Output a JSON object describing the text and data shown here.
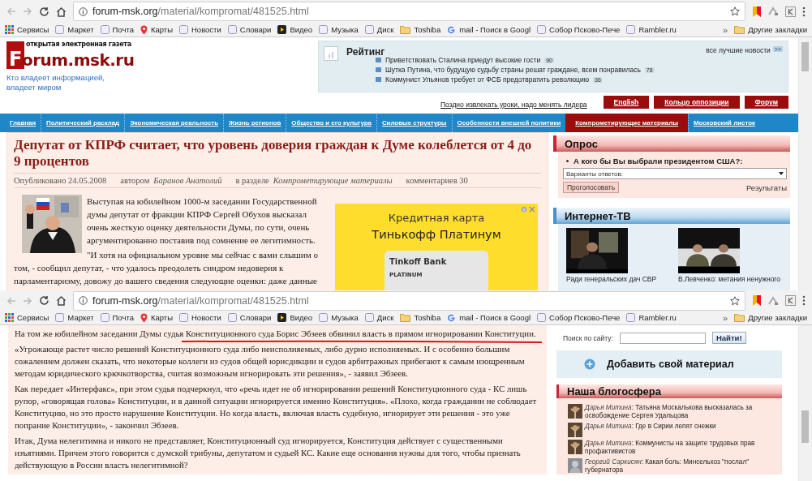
{
  "screens": [
    {
      "kind": "front",
      "browser": {
        "url_host": "forum-msk.org",
        "url_path": "/material/kompromat/481525.html",
        "more": "»",
        "other_bookmarks": "Другие закладки",
        "bookmarks": [
          {
            "label": "Сервисы",
            "kind": "apps"
          },
          {
            "label": "Маркет",
            "kind": "site"
          },
          {
            "label": "Почта",
            "kind": "site"
          },
          {
            "label": "Карты",
            "kind": "pin"
          },
          {
            "label": "Новости",
            "kind": "site"
          },
          {
            "label": "Словари",
            "kind": "site"
          },
          {
            "label": "Видео",
            "kind": "play"
          },
          {
            "label": "Музыка",
            "kind": "site"
          },
          {
            "label": "Диск",
            "kind": "site"
          },
          {
            "label": "Toshiba",
            "kind": "folder"
          },
          {
            "label": "mail - Поиск в Googl",
            "kind": "google"
          },
          {
            "label": "Собор Псково-Пече",
            "kind": "site"
          },
          {
            "label": "Rambler.ru",
            "kind": "site"
          }
        ]
      },
      "header": {
        "logo_top": "открытая электронная газета",
        "logo": "Forum.msk.ru",
        "slogan": "Кто владеет информацией, владеет миром",
        "rating": {
          "title": "Рейтинг",
          "all_link": "все лучшие новости",
          "all_badge": ">>",
          "items": [
            {
              "text": "Приветствовать Сталина приедут высокие гости",
              "count": "90"
            },
            {
              "text": "Шутка Путина, что будущую судьбу страны решат граждане, всем понравилась",
              "count": "78"
            },
            {
              "text": "Коммунист Ульянов требует от ФСБ предотвратить революцию",
              "count": "36"
            }
          ]
        },
        "headline_link": "Поздно извлекать уроки, надо менять лидера",
        "tabs": [
          "English",
          "Кольцо оппозиции",
          "Форум"
        ]
      },
      "nav": [
        {
          "label": "Главная",
          "selected": false
        },
        {
          "label": "Политический расклад",
          "selected": false
        },
        {
          "label": "Экономическая реальность",
          "selected": false
        },
        {
          "label": "Жизнь регионов",
          "selected": false
        },
        {
          "label": "Общество и его культура",
          "selected": false
        },
        {
          "label": "Силовые структуры",
          "selected": false
        },
        {
          "label": "Особенности внешней политики",
          "selected": false
        },
        {
          "label": "Компрометирующие материалы",
          "selected": true
        },
        {
          "label": "Московский листок",
          "selected": false
        }
      ],
      "article": {
        "title": "Депутат от КПРФ считает, что уровень доверия граждан к Думе колеблется от 4 до 9 процентов",
        "published": "Опубликовано 24.05.2008",
        "by": "автором",
        "author": "Баранов Анатолий",
        "in_section": "в разделе",
        "section": "Компрометирующие материалы",
        "comments": "комментариев 30",
        "paragraphs": [
          "Выступая на юбилейном 1000-м заседании Государственной думы депутат от фракции КПРФ Сергей Обухов высказал очень жесткую оценку деятельности Думы, по сути, очень аргументированно поставив под сомнение ее легитимность.",
          "\"И хотя на официальном уровне мы сейчас с вами слышим о том, - сообщил депутат, - что удалось преодолеть синдром недоверия к парламентаризму, довожу до вашего сведения следующие оценки: даже данные"
        ],
        "ad": {
          "line1": "Кредитная карта",
          "line2": "Тинькофф Платинум",
          "card_bank": "Tinkoff Bank",
          "card_tier": "PLATINUM"
        }
      },
      "sidebar": {
        "poll": {
          "title": "Опрос",
          "question": "А кого бы Вы выбрали президентом США?:",
          "select": "Варианты ответов:",
          "vote": "Проголосовать",
          "results": "Результаты"
        },
        "tv": {
          "title": "Интернет-ТВ",
          "videos": [
            {
              "caption": "Ради генеральских дач СВР"
            },
            {
              "caption": "В.Левченко: метания ненужного"
            }
          ]
        }
      }
    },
    {
      "kind": "continued",
      "browser": {
        "url_host": "forum-msk.org",
        "url_path": "/material/kompromat/481525.html",
        "more": "»",
        "other_bookmarks": "Другие закладки",
        "bookmarks": [
          {
            "label": "Сервисы",
            "kind": "apps"
          },
          {
            "label": "Маркет",
            "kind": "site"
          },
          {
            "label": "Почта",
            "kind": "site"
          },
          {
            "label": "Карты",
            "kind": "pin"
          },
          {
            "label": "Новости",
            "kind": "site"
          },
          {
            "label": "Словари",
            "kind": "site"
          },
          {
            "label": "Видео",
            "kind": "play"
          },
          {
            "label": "Музыка",
            "kind": "site"
          },
          {
            "label": "Диск",
            "kind": "site"
          },
          {
            "label": "Toshiba",
            "kind": "folder"
          },
          {
            "label": "mail - Поиск в Googl",
            "kind": "google"
          },
          {
            "label": "Собор Псково-Пече",
            "kind": "site"
          },
          {
            "label": "Rambler.ru",
            "kind": "site"
          }
        ]
      },
      "article": {
        "paragraphs": [
          {
            "text": "На том же юбилейном заседании Думы судья Конституционного суда Борис Эбзеев обвинил власть в прямом игнорировании Конституции.",
            "annotated": true
          },
          {
            "text": "«Угрожающе растет число решений Конституционного суда либо неисполняемых, либо дурно исполняемых. И с особенно большим сожалением должен сказать, что некоторые коллеги из судов общей юрисдикции и судов арбитражных прибегают к самым изощренным методам юридического крючкотворства, считая возможным игнорировать эти решения», - заявил Эбзеев.",
            "annotated": false
          },
          {
            "text": "Как передает «Интерфакс», при этом судья подчеркнул, что «речь идет не об игнорировании решений Конституционного суда - КС лишь рупор, «говорящая голова» Конституции, и в данной ситуации игнорируется именно Конституция». «Плохо, когда гражданин не соблюдает Конституцию, но это просто нарушение Конституции. Но когда власть, включая власть судебную, игнорирует эти решения - это уже попрание Конституции», - закончил Эбзеев.",
            "annotated": false
          },
          {
            "text": "Итак, Дума нелегитимна и никого не представляет, Конституционный суд игнорируется, Конституция действует с существенными изъятиями. Причем этого говорится с думской трибуны, депутатом и судьей КС. Какие еще основания нужны для того, чтобы признать действующую в России власть нелегитимной?",
            "annotated": false
          }
        ]
      },
      "sidebar": {
        "search_label": "Поиск по сайту:",
        "search_button": "Найти!",
        "add_material": "Добавить свой материал",
        "blog": {
          "title": "Наша блогосфера",
          "entries": [
            {
              "text": "*Дарья Митина*: Татьяна Москалькова высказалась за освобождение Сергея Удальцова"
            },
            {
              "text": "*Дарья Митина*: Где в Сирии лепят снежки"
            },
            {
              "text": "*Дарья Митина*: Коммунисты на защите трудовых прав профактивистов"
            },
            {
              "text": "*Георгий Саркисян*: Какая боль: Минсельхоз \"послал\" губернатора"
            }
          ]
        }
      }
    }
  ]
}
